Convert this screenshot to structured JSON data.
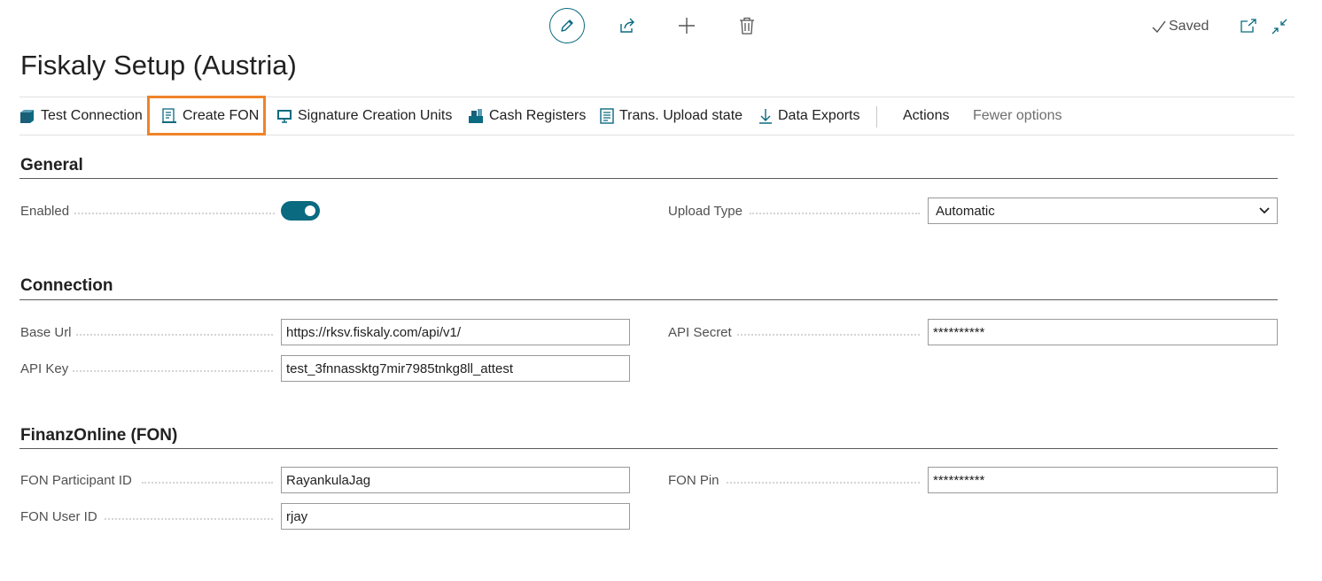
{
  "header": {
    "title": "Fiskaly Setup (Austria)",
    "status": "Saved"
  },
  "actions": {
    "test_connection": "Test Connection",
    "create_fon": "Create FON",
    "signature_creation_units": "Signature Creation Units",
    "cash_registers": "Cash Registers",
    "trans_upload_state": "Trans. Upload state",
    "data_exports": "Data Exports",
    "actions_menu": "Actions",
    "fewer_options": "Fewer options"
  },
  "sections": {
    "general": {
      "title": "General",
      "enabled_label": "Enabled",
      "enabled_value": true,
      "upload_type_label": "Upload Type",
      "upload_type_value": "Automatic"
    },
    "connection": {
      "title": "Connection",
      "base_url_label": "Base Url",
      "base_url_value": "https://rksv.fiskaly.com/api/v1/",
      "api_key_label": "API Key",
      "api_key_value": "test_3fnnassktg7mir7985tnkg8ll_attest",
      "api_secret_label": "API Secret",
      "api_secret_value": "**********"
    },
    "fon": {
      "title": "FinanzOnline (FON)",
      "participant_id_label": "FON Participant ID",
      "participant_id_value": "RayankulaJag",
      "user_id_label": "FON User ID",
      "user_id_value": "rjay",
      "pin_label": "FON Pin",
      "pin_value": "**********"
    }
  },
  "colors": {
    "accent": "#0a6a80",
    "highlight": "#f08328"
  }
}
